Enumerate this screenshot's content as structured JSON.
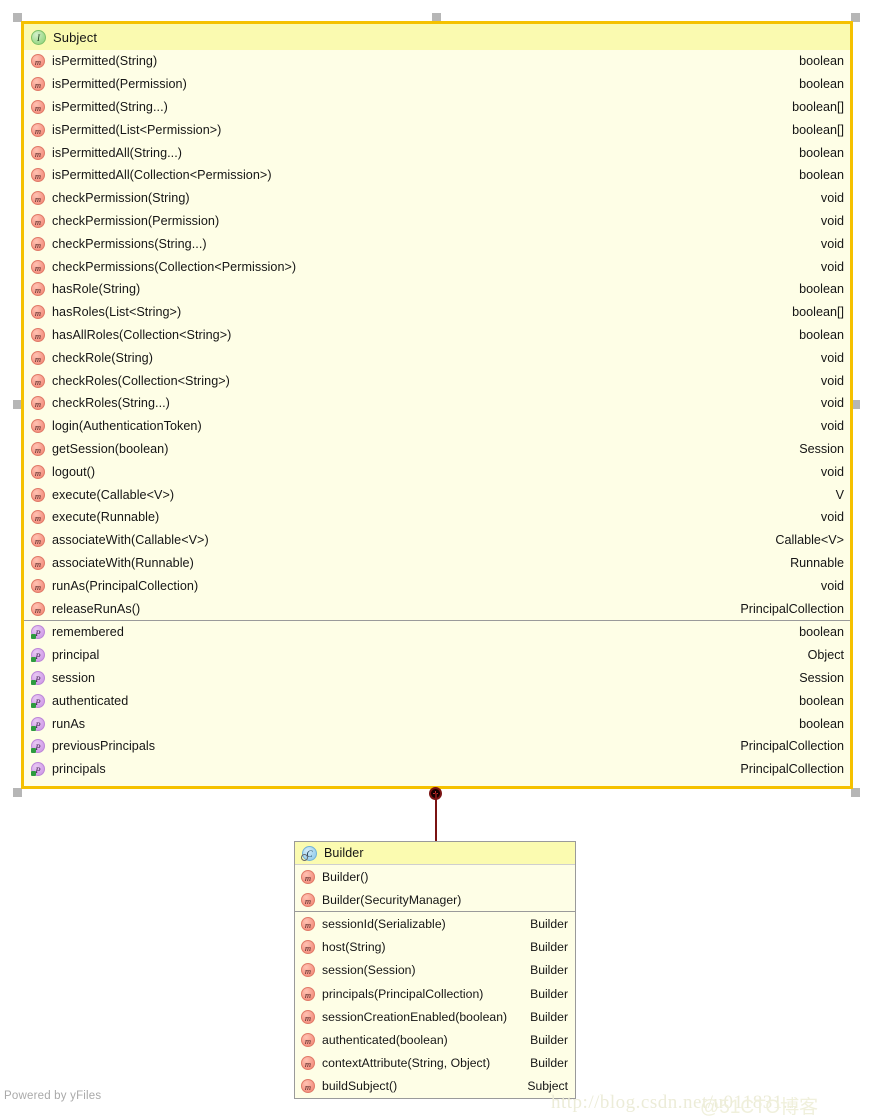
{
  "diagram": {
    "tool_footer": "Powered by yFiles",
    "watermark_url": "http://blog.csdn.net/u011831...",
    "watermark_brand": "@51CTO博客",
    "colors": {
      "class_border": "#f5c100",
      "class_body": "#fefee6",
      "header_band": "#fafab0",
      "connector": "#7a1313",
      "method_icon": "#ef8472",
      "field_icon": "#cb96e4",
      "interface_icon": "#8ed17a",
      "class_icon": "#8ec7e8",
      "handle": "#b6b6b6"
    }
  },
  "subject": {
    "title": "Subject",
    "stereotype_icon": "interface-icon",
    "stereotype_letter": "I",
    "methods": [
      {
        "name": "isPermitted(String)",
        "type": "boolean",
        "icon": "method-icon",
        "letter": "m"
      },
      {
        "name": "isPermitted(Permission)",
        "type": "boolean",
        "icon": "method-icon",
        "letter": "m"
      },
      {
        "name": "isPermitted(String...)",
        "type": "boolean[]",
        "icon": "method-icon",
        "letter": "m"
      },
      {
        "name": "isPermitted(List<Permission>)",
        "type": "boolean[]",
        "icon": "method-icon",
        "letter": "m"
      },
      {
        "name": "isPermittedAll(String...)",
        "type": "boolean",
        "icon": "method-icon",
        "letter": "m"
      },
      {
        "name": "isPermittedAll(Collection<Permission>)",
        "type": "boolean",
        "icon": "method-icon",
        "letter": "m"
      },
      {
        "name": "checkPermission(String)",
        "type": "void",
        "icon": "method-icon",
        "letter": "m"
      },
      {
        "name": "checkPermission(Permission)",
        "type": "void",
        "icon": "method-icon",
        "letter": "m"
      },
      {
        "name": "checkPermissions(String...)",
        "type": "void",
        "icon": "method-icon",
        "letter": "m"
      },
      {
        "name": "checkPermissions(Collection<Permission>)",
        "type": "void",
        "icon": "method-icon",
        "letter": "m"
      },
      {
        "name": "hasRole(String)",
        "type": "boolean",
        "icon": "method-icon",
        "letter": "m"
      },
      {
        "name": "hasRoles(List<String>)",
        "type": "boolean[]",
        "icon": "method-icon",
        "letter": "m"
      },
      {
        "name": "hasAllRoles(Collection<String>)",
        "type": "boolean",
        "icon": "method-icon",
        "letter": "m"
      },
      {
        "name": "checkRole(String)",
        "type": "void",
        "icon": "method-icon",
        "letter": "m"
      },
      {
        "name": "checkRoles(Collection<String>)",
        "type": "void",
        "icon": "method-icon",
        "letter": "m"
      },
      {
        "name": "checkRoles(String...)",
        "type": "void",
        "icon": "method-icon",
        "letter": "m"
      },
      {
        "name": "login(AuthenticationToken)",
        "type": "void",
        "icon": "method-icon",
        "letter": "m"
      },
      {
        "name": "getSession(boolean)",
        "type": "Session",
        "icon": "method-icon",
        "letter": "m"
      },
      {
        "name": "logout()",
        "type": "void",
        "icon": "method-icon",
        "letter": "m"
      },
      {
        "name": "execute(Callable<V>)",
        "type": "V",
        "icon": "method-icon",
        "letter": "m"
      },
      {
        "name": "execute(Runnable)",
        "type": "void",
        "icon": "method-icon",
        "letter": "m"
      },
      {
        "name": "associateWith(Callable<V>)",
        "type": "Callable<V>",
        "icon": "method-icon",
        "letter": "m"
      },
      {
        "name": "associateWith(Runnable)",
        "type": "Runnable",
        "icon": "method-icon",
        "letter": "m"
      },
      {
        "name": "runAs(PrincipalCollection)",
        "type": "void",
        "icon": "method-icon",
        "letter": "m"
      },
      {
        "name": "releaseRunAs()",
        "type": "PrincipalCollection",
        "icon": "method-icon",
        "letter": "m"
      }
    ],
    "fields": [
      {
        "name": "remembered",
        "type": "boolean",
        "icon": "property-icon",
        "letter": "P"
      },
      {
        "name": "principal",
        "type": "Object",
        "icon": "property-icon",
        "letter": "P"
      },
      {
        "name": "session",
        "type": "Session",
        "icon": "property-icon",
        "letter": "P"
      },
      {
        "name": "authenticated",
        "type": "boolean",
        "icon": "property-icon",
        "letter": "P"
      },
      {
        "name": "runAs",
        "type": "boolean",
        "icon": "property-icon",
        "letter": "P"
      },
      {
        "name": "previousPrincipals",
        "type": "PrincipalCollection",
        "icon": "property-icon",
        "letter": "P"
      },
      {
        "name": "principals",
        "type": "PrincipalCollection",
        "icon": "property-icon",
        "letter": "P"
      }
    ]
  },
  "builder": {
    "title": "Builder",
    "stereotype_icon": "class-icon",
    "stereotype_letter": "C",
    "constructors": [
      {
        "name": "Builder()",
        "type": "",
        "icon": "method-icon",
        "letter": "m"
      },
      {
        "name": "Builder(SecurityManager)",
        "type": "",
        "icon": "method-icon",
        "letter": "m"
      }
    ],
    "methods": [
      {
        "name": "sessionId(Serializable)",
        "type": "Builder",
        "icon": "method-icon",
        "letter": "m"
      },
      {
        "name": "host(String)",
        "type": "Builder",
        "icon": "method-icon",
        "letter": "m"
      },
      {
        "name": "session(Session)",
        "type": "Builder",
        "icon": "method-icon",
        "letter": "m"
      },
      {
        "name": "principals(PrincipalCollection)",
        "type": "Builder",
        "icon": "method-icon",
        "letter": "m"
      },
      {
        "name": "sessionCreationEnabled(boolean)",
        "type": "Builder",
        "icon": "method-icon",
        "letter": "m"
      },
      {
        "name": "authenticated(boolean)",
        "type": "Builder",
        "icon": "method-icon",
        "letter": "m"
      },
      {
        "name": "contextAttribute(String, Object)",
        "type": "Builder",
        "icon": "method-icon",
        "letter": "m"
      },
      {
        "name": "buildSubject()",
        "type": "Subject",
        "icon": "method-icon",
        "letter": "m"
      }
    ]
  }
}
